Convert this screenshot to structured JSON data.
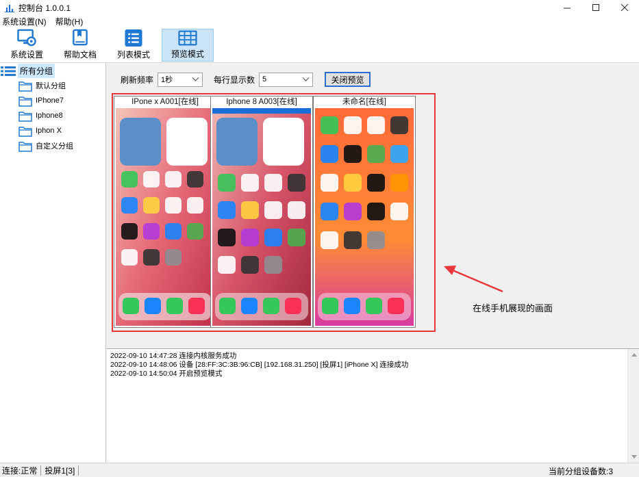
{
  "window": {
    "title": "控制台 1.0.0.1",
    "controls": [
      "minimize-icon",
      "maximize-icon",
      "close-icon"
    ]
  },
  "menu": {
    "items": [
      "系统设置(N)",
      "帮助(H)"
    ]
  },
  "toolbar": {
    "items": [
      {
        "label": "系统设置",
        "icon": "settings-gear-icon",
        "active": false
      },
      {
        "label": "帮助文档",
        "icon": "book-icon",
        "active": false
      },
      {
        "label": "列表模式",
        "icon": "list-icon",
        "active": false
      },
      {
        "label": "预览模式",
        "icon": "grid-icon",
        "active": true
      }
    ]
  },
  "tree": {
    "root": "所有分组",
    "groups": [
      "默认分组",
      "IPhone7",
      "Iphone8",
      "Iphon X",
      "自定义分组"
    ]
  },
  "controls": {
    "refresh_label": "刷新频率",
    "refresh_value": "1秒",
    "per_row_label": "每行显示数",
    "per_row_value": "5",
    "close_preview": "关闭预览"
  },
  "phones": [
    {
      "title": "IPone x A001[在线]",
      "wallpaper": "#d3455b"
    },
    {
      "title": "Iphone 8 A003[在线]",
      "wallpaper": "#c23a4f"
    },
    {
      "title": "未命名[在线]",
      "wallpaper": "#e8452f"
    }
  ],
  "annotation": "在线手机展现的画面",
  "log": [
    "2022-09-10 14:47:28  连接内核服务成功",
    "2022-09-10 14:48:06  设备 [28:FF:3C:3B:96:CB]  [192.168.31.250]  [投屏1]  [iPhone X]  连接成功",
    "2022-09-10 14:50:04  开启预览模式"
  ],
  "status": {
    "connection": "连接:正常",
    "screen": "投屏1[3]",
    "group_count": "当前分组设备数:3"
  },
  "colors": {
    "accent": "#2a6ed1",
    "highlight": "#e8363a",
    "selection": "#cce4f7"
  }
}
